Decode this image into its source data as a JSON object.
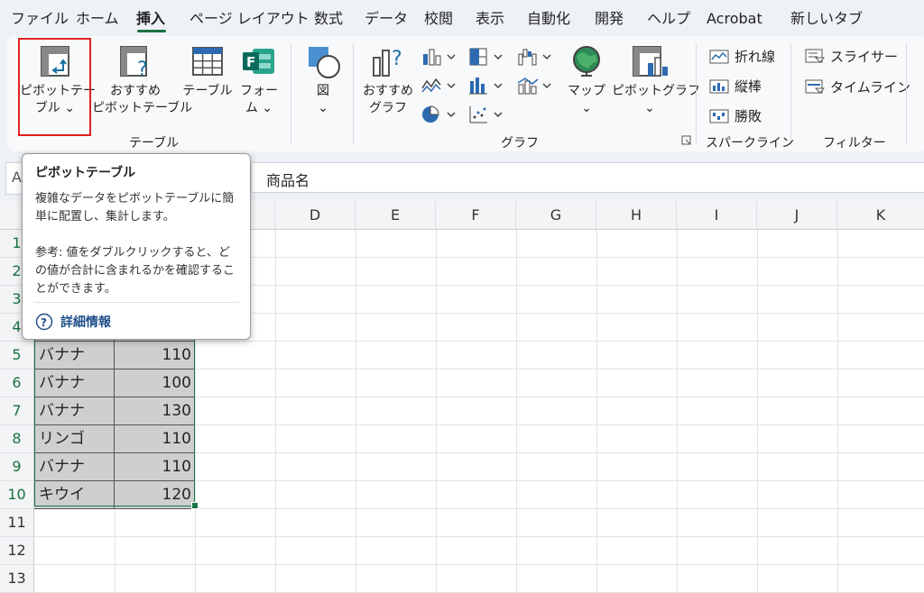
{
  "menu": {
    "items": [
      "ファイル",
      "ホーム",
      "挿入",
      "ページ レイアウト",
      "数式",
      "データ",
      "校閲",
      "表示",
      "自動化",
      "開発",
      "ヘルプ",
      "Acrobat",
      "新しいタブ"
    ],
    "active": "挿入"
  },
  "ribbon": {
    "pivot_table": [
      "ピボットテー",
      "ブル ⌄"
    ],
    "recommended_pivot": [
      "おすすめ",
      "ピボットテーブル"
    ],
    "table": "テーブル",
    "forms": [
      "フォー",
      "ム ⌄"
    ],
    "illustrations": [
      "図",
      "⌄"
    ],
    "recommended_charts": [
      "おすすめ",
      "グラフ"
    ],
    "maps": [
      "マップ",
      "⌄"
    ],
    "pivot_chart": [
      "ピボットグラフ",
      "⌄"
    ],
    "sparkline_line": "折れ線",
    "sparkline_column": "縦棒",
    "sparkline_winloss": "勝敗",
    "slicer": "スライサー",
    "timeline": "タイムライン",
    "group_tables": "テーブル",
    "group_charts": "グラフ",
    "group_sparklines": "スパークライン",
    "group_filters": "フィルター"
  },
  "formula_bar": {
    "name_box": "A",
    "content": "商品名"
  },
  "columns": [
    "D",
    "E",
    "F",
    "G",
    "H",
    "I",
    "J",
    "K"
  ],
  "rows": [
    "1",
    "2",
    "3",
    "4",
    "5",
    "6",
    "7",
    "8",
    "9",
    "10",
    "11",
    "12",
    "13"
  ],
  "table_rows": [
    {
      "name": "バナナ",
      "value": "110"
    },
    {
      "name": "バナナ",
      "value": "100"
    },
    {
      "name": "バナナ",
      "value": "130"
    },
    {
      "name": "リンゴ",
      "value": "110"
    },
    {
      "name": "バナナ",
      "value": "110"
    },
    {
      "name": "キウイ",
      "value": "120"
    }
  ],
  "tooltip": {
    "title": "ピボットテーブル",
    "body": "複雑なデータをピボットテーブルに簡単に配置し、集計します。",
    "note": "参考: 値をダブルクリックすると、どの値が合計に含まれるかを確認することができます。",
    "link": "詳細情報"
  },
  "colors": {
    "accent": "#1a7343",
    "highlight": "#e02020",
    "selection_fill": "#cfcfcf"
  }
}
